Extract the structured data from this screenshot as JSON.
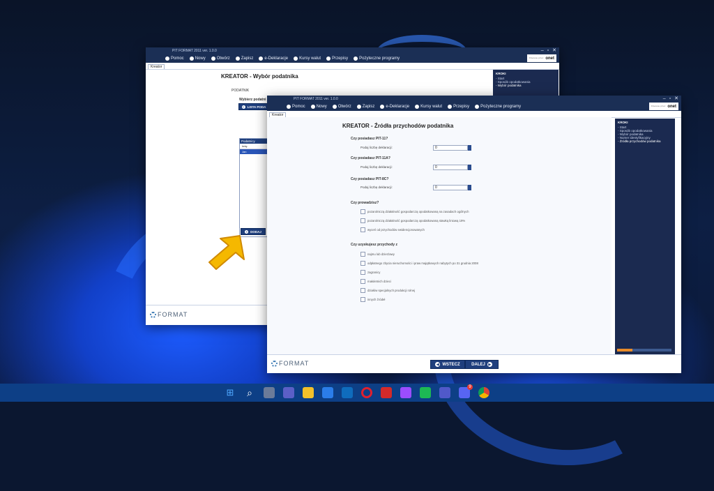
{
  "taskbar": {
    "icons": [
      "windows-start",
      "search",
      "task-view",
      "teams",
      "file-explorer",
      "store",
      "mail",
      "opera",
      "wps",
      "messenger",
      "spotify",
      "teams-purple",
      "discord",
      "chrome"
    ],
    "discord_badge": "9"
  },
  "back_window": {
    "title": "PIT FORMAT 2011 ver. 1.0.0",
    "logo_year": "2011",
    "menu": [
      "Pomoc",
      "Nowy",
      "Otwórz",
      "Zapisz",
      "e-Deklaracje",
      "Kursy walut",
      "Przepisy",
      "Pożyteczne programy"
    ],
    "onet_label": "onet",
    "onet_small": "Polecane\nprzez",
    "tab": "Kreator",
    "heading": "KREATOR - Wybór podatnika",
    "section": "PODATNIK",
    "choose_label": "Wybierz podatni",
    "list_button": "LISTA PODA",
    "list_header": "Podatnicy",
    "list_rows": [
      "Imię",
      "Jan"
    ],
    "add_button": "DODAJ",
    "side": {
      "title": "KROKI",
      "items": [
        "- Start",
        "- Sposób opodatkowania",
        "- Wybór podatnika"
      ]
    },
    "footer_logo": "FORMAT"
  },
  "front_window": {
    "title": "PIT FORMAT 2011 ver. 1.0.0",
    "logo_year": "2011",
    "menu": [
      "Pomoc",
      "Nowy",
      "Otwórz",
      "Zapisz",
      "e-Deklaracje",
      "Kursy walut",
      "Przepisy",
      "Pożyteczne programy"
    ],
    "onet_label": "onet",
    "onet_small": "Polecane\nprzez",
    "tab": "Kreator",
    "heading": "KREATOR - Źródła przychodów podatnika",
    "q1": "Czy posiadasz PIT-11?",
    "q2": "Czy posiadasz PIT-11A?",
    "q3": "Czy posiadasz PIT-8C?",
    "count_label": "Podaj liczbę deklaracji:",
    "inputs": [
      "0",
      "0",
      "0"
    ],
    "q4": "Czy prowadzisz?",
    "business_options": [
      "pozarolniczą działalność gospodarczą opodatkowaną na zasadach ogólnych",
      "pozarolniczą działalność gospodarczą opodatkowaną stawką liniową 19%",
      "wyceń od przychodów ewidencjonowanych"
    ],
    "q5": "Czy uzyskujesz przychody z",
    "income_options": [
      "najmu lub dzierżawy",
      "odpłatnego zbycia nieruchomości i praw majątkowych nabytych po 31 grudnia 2008",
      "zagranicy",
      "małoletnich dzieci",
      "działów specjalnych produkcji rolnej",
      "innych źródeł"
    ],
    "side": {
      "title": "KROKI",
      "items": [
        "- Start",
        "- Sposób opodatkowania",
        "- Wybór podatnika",
        "- Numer identyfikacyjny",
        "- Źródła przychodów podatnika"
      ]
    },
    "back_button": "WSTECZ",
    "next_button": "DALEJ",
    "footer_logo": "FORMAT"
  },
  "colors": {
    "accent": "#1f3f7d",
    "arrow": "#f5b800"
  }
}
